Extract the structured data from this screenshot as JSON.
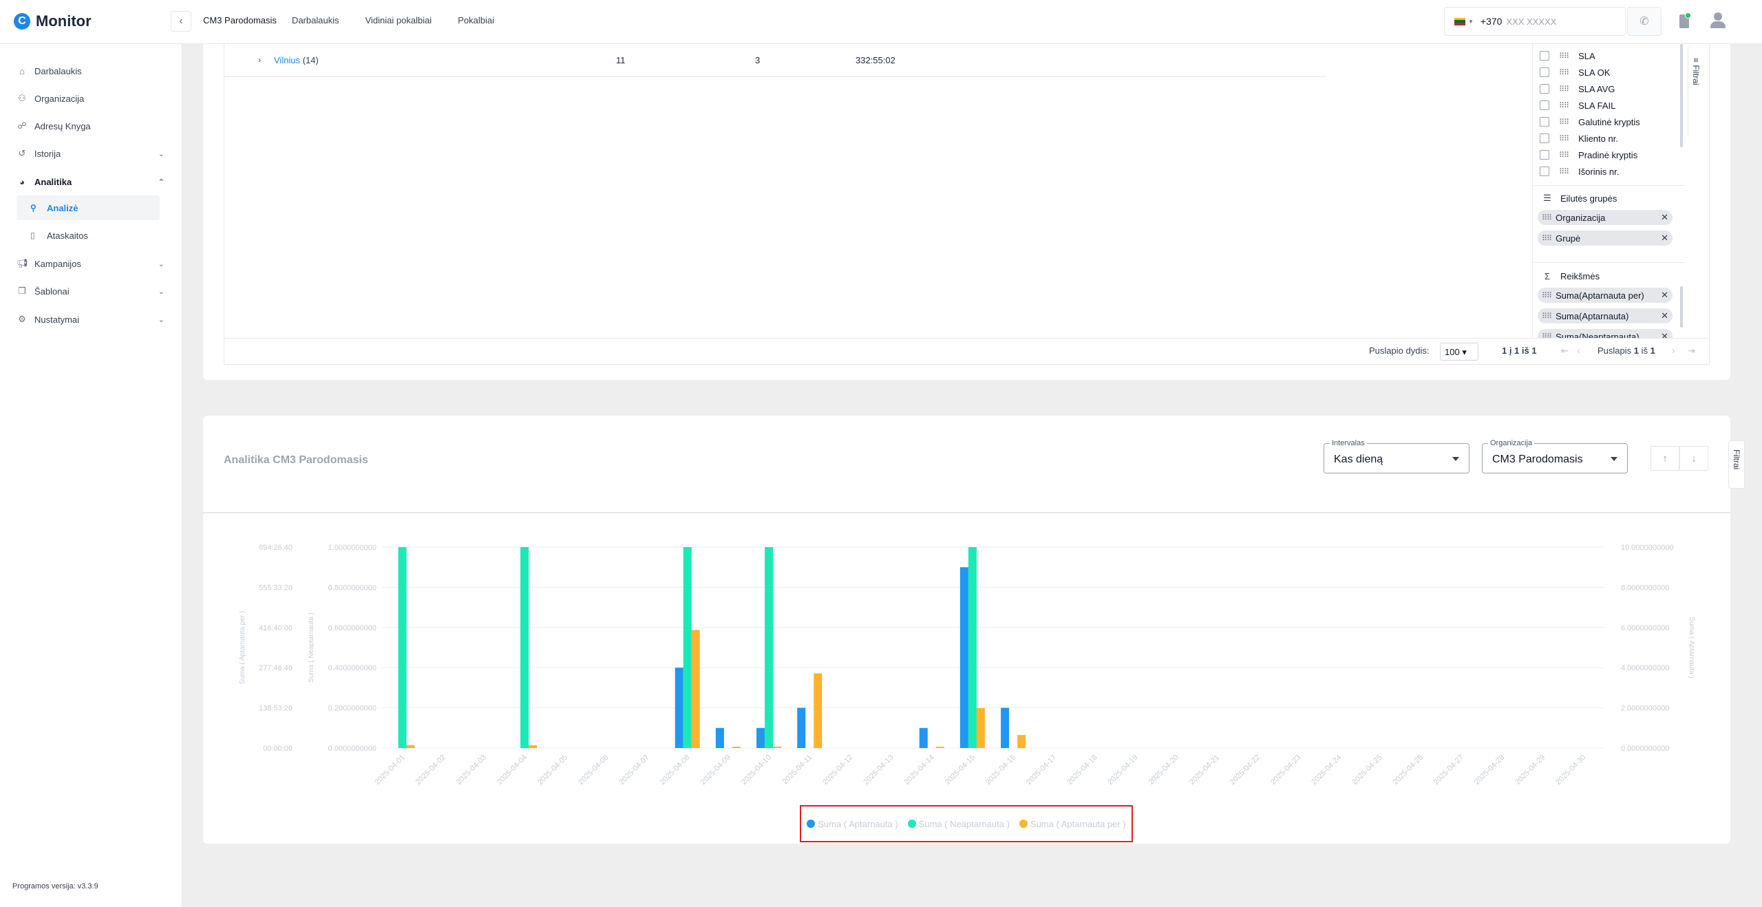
{
  "app": {
    "name": "Monitor",
    "version": "Programos versija: v3.3.9"
  },
  "topbar": {
    "org": "CM3 Parodomasis",
    "nav": [
      "Darbalaukis",
      "Vidiniai pokalbiai",
      "Pokalbiai"
    ],
    "phone_code": "+370",
    "phone_placeholder": "XXX XXXXX"
  },
  "sidebar": {
    "items": [
      {
        "label": "Darbalaukis",
        "icon": "home-icon"
      },
      {
        "label": "Organizacija",
        "icon": "org-icon"
      },
      {
        "label": "Adresų Knyga",
        "icon": "address-book-icon"
      },
      {
        "label": "Istorija",
        "icon": "history-icon"
      },
      {
        "label": "Analitika",
        "icon": "pie-chart-icon"
      },
      {
        "label": "Kampanijos",
        "icon": "megaphone-icon"
      },
      {
        "label": "Šablonai",
        "icon": "template-icon"
      },
      {
        "label": "Nustatymai",
        "icon": "gear-icon"
      }
    ],
    "sub_items": [
      {
        "label": "Analizė",
        "icon": "search-icon"
      },
      {
        "label": "Ataskaitos",
        "icon": "document-icon"
      }
    ]
  },
  "table": {
    "row": {
      "name": "Vilnius",
      "count": "(14)",
      "c1": "11",
      "c2": "3",
      "c3": "332:55:02"
    }
  },
  "tool_panel": {
    "columns": [
      "SLA",
      "SLA OK",
      "SLA AVG",
      "SLA FAIL",
      "Galutinė kryptis",
      "Kliento nr.",
      "Pradinė kryptis",
      "Išorinis nr."
    ],
    "row_groups_title": "Eilutės grupės",
    "row_groups": [
      "Organizacija",
      "Grupė"
    ],
    "values_title": "Reikšmės",
    "values": [
      "Suma(Aptarnauta per)",
      "Suma(Aptarnauta)",
      "Suma(Neaptarnauta)"
    ],
    "filters_label": "Filtrai"
  },
  "pager": {
    "size_label": "Puslapio dydis:",
    "size": "100",
    "range": "1 į 1 iš 1",
    "page_label": "Puslapis",
    "page": "1",
    "of": "iš",
    "total": "1"
  },
  "analytics": {
    "title": "Analitika CM3 Parodomasis",
    "interval_label": "Intervalas",
    "interval_value": "Kas dieną",
    "org_label": "Organizacija",
    "org_value": "CM3 Parodomasis",
    "filters_label": "Filtrai"
  },
  "colors": {
    "blue": "#2196f3",
    "green": "#1de9b6",
    "orange": "#ffb22e",
    "accent": "#1e88e5"
  },
  "chart_data": {
    "type": "bar",
    "categories": [
      "2025-04-01",
      "2025-04-02",
      "2025-04-03",
      "2025-04-04",
      "2025-04-05",
      "2025-04-06",
      "2025-04-07",
      "2025-04-08",
      "2025-04-09",
      "2025-04-10",
      "2025-04-11",
      "2025-04-12",
      "2025-04-13",
      "2025-04-14",
      "2025-04-15",
      "2025-04-16",
      "2025-04-17",
      "2025-04-18",
      "2025-04-19",
      "2025-04-20",
      "2025-04-21",
      "2025-04-22",
      "2025-04-23",
      "2025-04-24",
      "2025-04-25",
      "2025-04-26",
      "2025-04-27",
      "2025-04-28",
      "2025-04-29",
      "2025-04-30"
    ],
    "series": [
      {
        "name": "Suma ( Aptarnauta )",
        "axis": "right",
        "values": [
          0,
          0,
          0,
          0,
          0,
          0,
          0,
          4,
          1,
          1,
          2,
          0,
          0,
          1,
          9,
          2,
          0,
          0,
          0,
          0,
          0,
          0,
          0,
          0,
          0,
          0,
          0,
          0,
          0,
          0
        ]
      },
      {
        "name": "Suma ( Neaptarnauta )",
        "axis": "middle",
        "values": [
          1,
          0,
          0,
          1,
          0,
          0,
          0,
          1,
          0,
          1,
          0,
          0,
          0,
          0,
          1,
          0,
          0,
          0,
          0,
          0,
          0,
          0,
          0,
          0,
          0,
          0,
          0,
          0,
          0,
          0
        ]
      },
      {
        "name": "Suma ( Aptarnauta per )",
        "axis": "left",
        "values": [
          10,
          0,
          0,
          10,
          0,
          0,
          0,
          408,
          2,
          5,
          258,
          0,
          0,
          2,
          138,
          45,
          0,
          0,
          0,
          0,
          0,
          0,
          0,
          0,
          0,
          0,
          0,
          0,
          0,
          0
        ]
      }
    ],
    "left_axis": {
      "label": "Suma ( Aptarnauta per )",
      "ticks": [
        "694:26:40",
        "555:33:20",
        "416:40:00",
        "277:46:40",
        "138:53:20",
        "00:00:00"
      ],
      "max": 694.44
    },
    "middle_axis": {
      "label": "Suma ( Neaptarnauta )",
      "ticks": [
        "1.0000000000",
        "0.8000000000",
        "0.6000000000",
        "0.4000000000",
        "0.2000000000",
        "0.0000000000"
      ],
      "max": 1
    },
    "right_axis": {
      "label": "Suma ( Aptarnauta )",
      "ticks": [
        "10.0000000000",
        "8.0000000000",
        "6.0000000000",
        "4.0000000000",
        "2.0000000000",
        "0.0000000000"
      ],
      "max": 10
    },
    "legend": "bottom",
    "grid": true
  }
}
